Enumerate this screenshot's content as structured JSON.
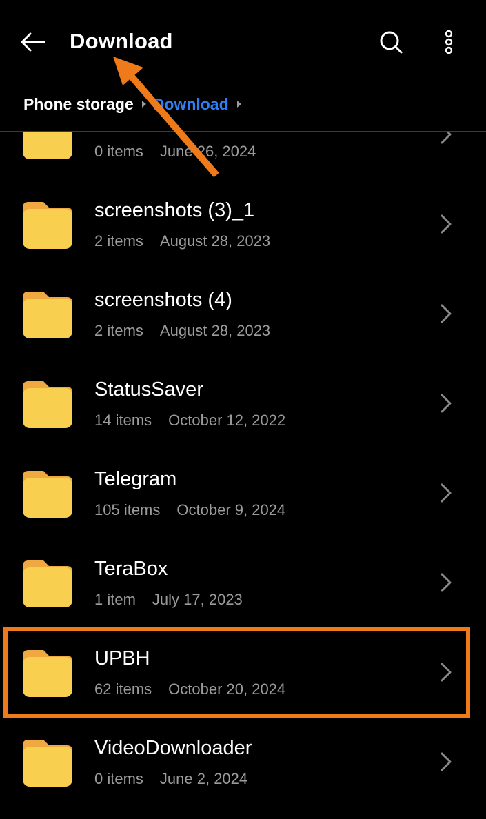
{
  "header": {
    "title": "Download",
    "back_icon": "arrow-left-icon",
    "search_icon": "search-icon",
    "more_icon": "more-vertical-icon"
  },
  "breadcrumb": {
    "root": "Phone storage",
    "current": "Download"
  },
  "colors": {
    "background": "#000000",
    "accent_blue": "#2f7ff1",
    "folder_yellow": "#f8cf4f",
    "folder_tab": "#f0a840",
    "annotation_orange": "#ef7a1a"
  },
  "folders": [
    {
      "name": "",
      "items": "0 items",
      "date": "June 26, 2024"
    },
    {
      "name": "screenshots (3)_1",
      "items": "2 items",
      "date": "August 28, 2023"
    },
    {
      "name": "screenshots (4)",
      "items": "2 items",
      "date": "August 28, 2023"
    },
    {
      "name": "StatusSaver",
      "items": "14 items",
      "date": "October 12, 2022"
    },
    {
      "name": "Telegram",
      "items": "105 items",
      "date": "October 9, 2024"
    },
    {
      "name": "TeraBox",
      "items": "1 item",
      "date": "July 17, 2023"
    },
    {
      "name": "UPBH",
      "items": "62 items",
      "date": "October 20, 2024"
    },
    {
      "name": "VideoDownloader",
      "items": "0 items",
      "date": "June 2, 2024"
    }
  ]
}
